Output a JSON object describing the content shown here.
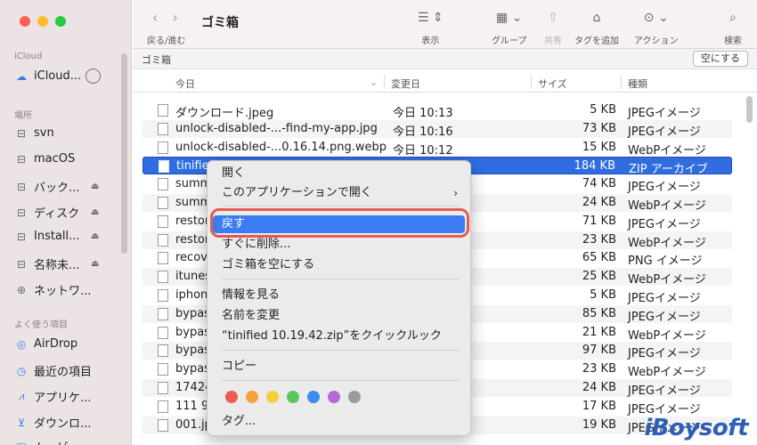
{
  "window": {
    "title": "ゴミ箱"
  },
  "toolbar": {
    "nav_label": "戻る/進む",
    "back_icon": "chevron-left-icon",
    "forward_icon": "chevron-right-icon",
    "buttons": [
      {
        "icon": "list-view-icon",
        "label": "表示"
      },
      {
        "icon": "grid-group-icon",
        "label": "グループ"
      },
      {
        "icon": "share-icon",
        "label": "共有",
        "disabled": true
      },
      {
        "icon": "tag-icon",
        "label": "タグを追加"
      },
      {
        "icon": "action-ellipsis-icon",
        "label": "アクション"
      },
      {
        "icon": "search-icon",
        "label": "検索"
      }
    ]
  },
  "sidebar": {
    "sections": [
      {
        "title": "iCloud",
        "items": [
          {
            "label": "iCloud...",
            "icon": "cloud-icon"
          }
        ]
      },
      {
        "title": "場所",
        "items": [
          {
            "label": "svn",
            "icon": "drive-icon"
          },
          {
            "label": "macOS",
            "icon": "drive-icon"
          },
          {
            "label": "バック...",
            "icon": "drive-icon",
            "eject": true
          },
          {
            "label": "ディスク",
            "icon": "drive-icon",
            "eject": true
          },
          {
            "label": "Install...",
            "icon": "drive-icon",
            "eject": true
          },
          {
            "label": "名称未...",
            "icon": "drive-icon",
            "eject": true
          },
          {
            "label": "ネットワ...",
            "icon": "network-icon"
          }
        ]
      },
      {
        "title": "よく使う項目",
        "items": [
          {
            "label": "AirDrop",
            "icon": "airdrop-icon"
          },
          {
            "label": "最近の項目",
            "icon": "clock-icon"
          },
          {
            "label": "アプリケ...",
            "icon": "applications-icon"
          },
          {
            "label": "ダウンロ...",
            "icon": "download-icon"
          },
          {
            "label": "ムービー",
            "icon": "movie-icon"
          }
        ]
      }
    ]
  },
  "pathbar": {
    "label": "ゴミ箱",
    "empty_button": "空にする"
  },
  "columns": {
    "name": "今日",
    "date": "変更日",
    "size": "サイズ",
    "kind": "種類"
  },
  "files": [
    {
      "name": "ダウンロード.jpeg",
      "date": "今日 10:13",
      "size": "5 KB",
      "kind": "JPEGイメージ"
    },
    {
      "name": "unlock-disabled-...-find-my-app.jpg",
      "date": "今日 10:16",
      "size": "73 KB",
      "kind": "JPEGイメージ"
    },
    {
      "name": "unlock-disabled-...0.16.14.png.webp",
      "date": "今日 10:12",
      "size": "15 KB",
      "kind": "WebPイメージ"
    },
    {
      "name": "tinifie",
      "date": "",
      "size": "184 KB",
      "kind": "ZIP アーカイブ",
      "selected": true
    },
    {
      "name": "summ",
      "date": "",
      "size": "74 KB",
      "kind": "JPEGイメージ"
    },
    {
      "name": "summ",
      "date": "",
      "size": "24 KB",
      "kind": "WebPイメージ"
    },
    {
      "name": "restor",
      "date": "",
      "size": "71 KB",
      "kind": "JPEGイメージ"
    },
    {
      "name": "restor",
      "date": "",
      "size": "23 KB",
      "kind": "WebPイメージ"
    },
    {
      "name": "recov",
      "date": "",
      "size": "65 KB",
      "kind": "PNG イメージ"
    },
    {
      "name": "itunes",
      "date": "",
      "size": "25 KB",
      "kind": "WebPイメージ"
    },
    {
      "name": "iphon",
      "date": "",
      "size": "5 KB",
      "kind": "JPEGイメージ"
    },
    {
      "name": "bypas",
      "date": "",
      "size": "85 KB",
      "kind": "JPEGイメージ"
    },
    {
      "name": "bypas",
      "date": "",
      "size": "21 KB",
      "kind": "WebPイメージ"
    },
    {
      "name": "bypas",
      "date": "",
      "size": "97 KB",
      "kind": "JPEGイメージ"
    },
    {
      "name": "bypas",
      "date": "",
      "size": "23 KB",
      "kind": "WebPイメージ"
    },
    {
      "name": "17424",
      "date": "",
      "size": "24 KB",
      "kind": "JPEGイメージ"
    },
    {
      "name": "111 9.",
      "date": "",
      "size": "17 KB",
      "kind": "JPEGイメージ"
    },
    {
      "name": "001.jp",
      "date": "",
      "size": "19 KB",
      "kind": "JPEGイメージ"
    }
  ],
  "context_menu": {
    "items": [
      {
        "label": "開く"
      },
      {
        "label": "このアプリケーションで開く",
        "submenu": true
      },
      {
        "label": "戻す",
        "highlighted": true
      },
      {
        "label": "すぐに削除..."
      },
      {
        "label": "ゴミ箱を空にする"
      },
      {
        "label": "情報を見る"
      },
      {
        "label": "名前を変更"
      },
      {
        "label": "“tinified 10.19.42.zip”をクイックルック"
      },
      {
        "label": "コピー"
      },
      {
        "label": "タグ..."
      }
    ],
    "tag_colors": [
      "#ee5b55",
      "#f6a13a",
      "#f4cf3a",
      "#5ac55a",
      "#3c8cf0",
      "#b36ad6",
      "#9a9a9a"
    ]
  },
  "watermark": "iBoysoft"
}
